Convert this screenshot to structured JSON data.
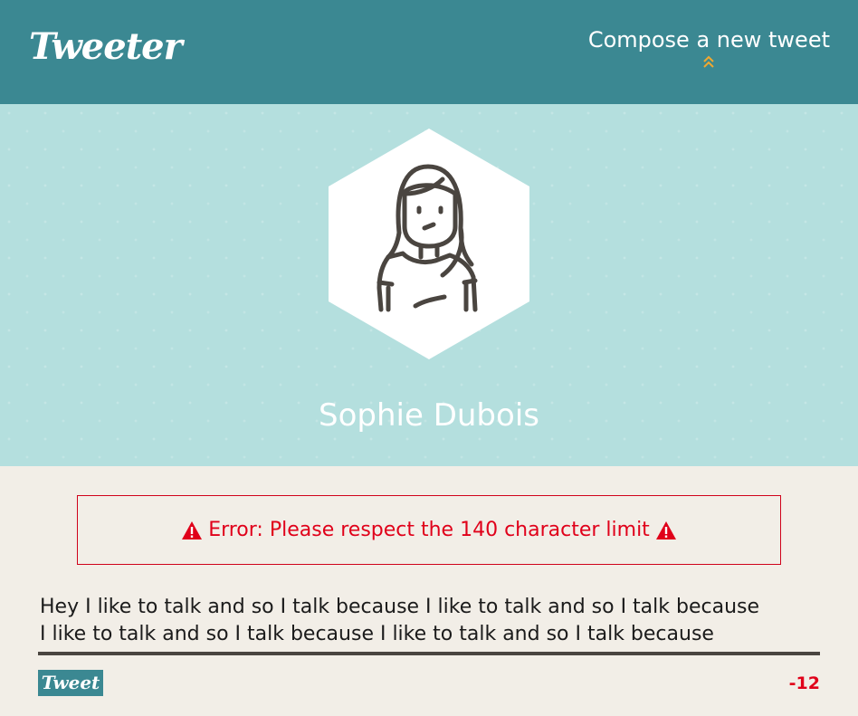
{
  "nav": {
    "logo": "Tweeter",
    "compose_label": "Compose a new tweet",
    "compose_icon": "double-chevron-up-icon",
    "accent_color": "#f0a830"
  },
  "profile": {
    "name": "Sophie Dubois",
    "avatar_icon": "woman-avatar-icon"
  },
  "error": {
    "message": "Error: Please respect the 140 character limit",
    "icon": "warning-triangle-icon",
    "color": "#e0001a"
  },
  "composer": {
    "text": "Hey I like to talk and so I talk because I like to talk and so I talk because\nI like to talk and so I talk because I like to talk and so I talk because",
    "submit_label": "Tweet",
    "counter": "-12"
  },
  "colors": {
    "nav_bg": "#3b8892",
    "hero_bg": "#b4dfde",
    "page_bg": "#f2eee7"
  }
}
